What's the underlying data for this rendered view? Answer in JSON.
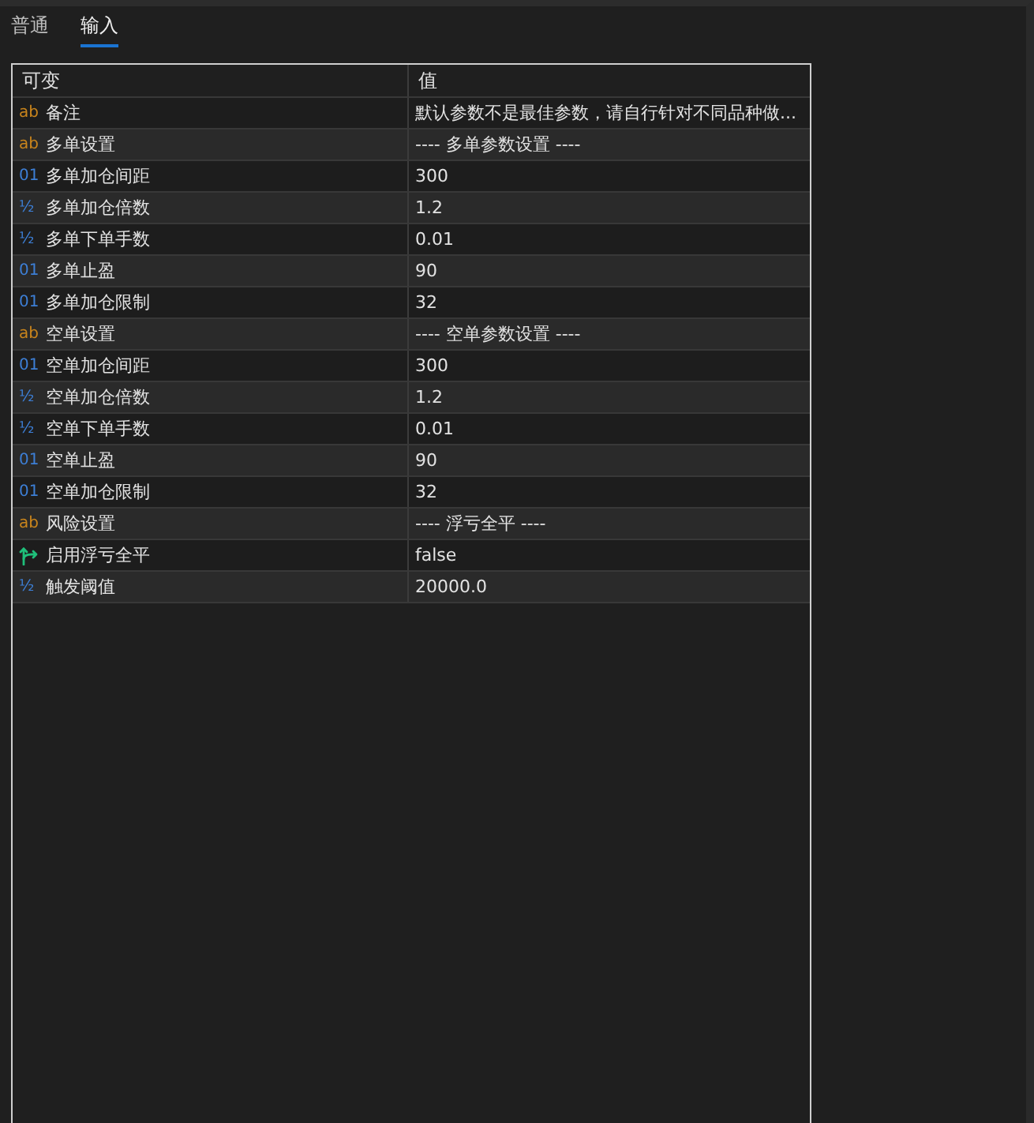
{
  "tabs": [
    {
      "label": "普通",
      "selected": false
    },
    {
      "label": "输入",
      "selected": true
    }
  ],
  "table": {
    "columns": [
      "可变",
      "值"
    ],
    "rows": [
      {
        "kind": "string",
        "type_mark": "ab",
        "name": "备注",
        "value": "默认参数不是最佳参数，请自行针对不同品种做..."
      },
      {
        "kind": "string",
        "type_mark": "ab",
        "name": "多单设置",
        "value": "---- 多单参数设置 ----"
      },
      {
        "kind": "int",
        "type_mark": "01",
        "name": "多单加仓间距",
        "value": "300"
      },
      {
        "kind": "double",
        "type_mark": "½",
        "name": "多单加仓倍数",
        "value": "1.2"
      },
      {
        "kind": "double",
        "type_mark": "½",
        "name": "多单下单手数",
        "value": "0.01"
      },
      {
        "kind": "int",
        "type_mark": "01",
        "name": "多单止盈",
        "value": "90"
      },
      {
        "kind": "int",
        "type_mark": "01",
        "name": "多单加仓限制",
        "value": "32"
      },
      {
        "kind": "string",
        "type_mark": "ab",
        "name": "空单设置",
        "value": "---- 空单参数设置 ----"
      },
      {
        "kind": "int",
        "type_mark": "01",
        "name": "空单加仓间距",
        "value": "300"
      },
      {
        "kind": "double",
        "type_mark": "½",
        "name": "空单加仓倍数",
        "value": "1.2"
      },
      {
        "kind": "double",
        "type_mark": "½",
        "name": "空单下单手数",
        "value": "0.01"
      },
      {
        "kind": "int",
        "type_mark": "01",
        "name": "空单止盈",
        "value": "90"
      },
      {
        "kind": "int",
        "type_mark": "01",
        "name": "空单加仓限制",
        "value": "32"
      },
      {
        "kind": "string",
        "type_mark": "ab",
        "name": "风险设置",
        "value": "---- 浮亏全平 ----"
      },
      {
        "kind": "bool",
        "name": "启用浮亏全平",
        "value": "false"
      },
      {
        "kind": "double",
        "type_mark": "½",
        "name": "触发阈值",
        "value": "20000.0"
      }
    ]
  }
}
